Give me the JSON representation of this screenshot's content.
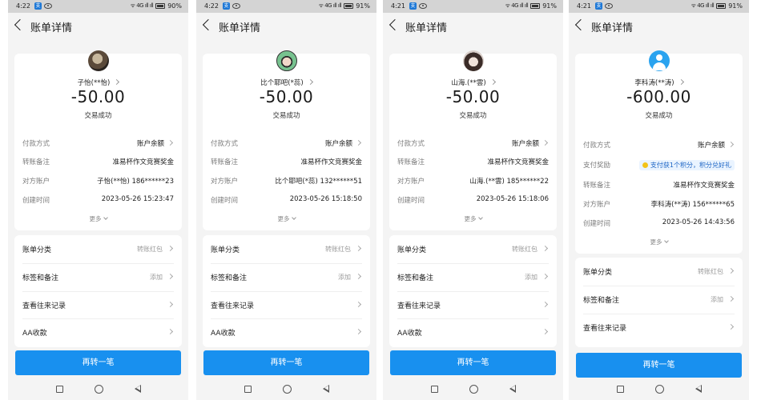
{
  "screens": [
    {
      "status": {
        "time": "4:22",
        "battery": "90%",
        "signal": "ᯤ 4G ıll ıll"
      },
      "title": "账单详情",
      "payee": "子怡(**怡)",
      "amount": "-50.00",
      "status_text": "交易成功",
      "details": [
        {
          "label": "付款方式",
          "value": "账户余额"
        },
        {
          "label": "转账备注",
          "value": "准易杯作文竞赛奖金"
        },
        {
          "label": "对方账户",
          "value": "子怡(**怡) 186******23"
        },
        {
          "label": "创建时间",
          "value": "2023-05-26 15:23:47"
        }
      ],
      "more": "更多",
      "list": [
        {
          "label": "账单分类",
          "value": "转账红包"
        },
        {
          "label": "标签和备注",
          "value": "添加"
        },
        {
          "label": "查看往来记录",
          "value": ""
        },
        {
          "label": "AA收款",
          "value": ""
        }
      ],
      "button": "再转一笔"
    },
    {
      "status": {
        "time": "4:22",
        "battery": "91%",
        "signal": "ᯤ 4G ıll ıll"
      },
      "title": "账单详情",
      "payee": "比个耶吧(*蕊)",
      "amount": "-50.00",
      "status_text": "交易成功",
      "details": [
        {
          "label": "付款方式",
          "value": "账户余额"
        },
        {
          "label": "转账备注",
          "value": "准易杯作文竞赛奖金"
        },
        {
          "label": "对方账户",
          "value": "比个耶吧(*蕊) 132******51"
        },
        {
          "label": "创建时间",
          "value": "2023-05-26 15:18:50"
        }
      ],
      "more": "更多",
      "list": [
        {
          "label": "账单分类",
          "value": "转账红包"
        },
        {
          "label": "标签和备注",
          "value": "添加"
        },
        {
          "label": "查看往来记录",
          "value": ""
        },
        {
          "label": "AA收款",
          "value": ""
        }
      ],
      "button": "再转一笔"
    },
    {
      "status": {
        "time": "4:21",
        "battery": "91%",
        "signal": "ᯤ 4G ıll ıll"
      },
      "title": "账单详情",
      "payee": "山海.(**雲)",
      "amount": "-50.00",
      "status_text": "交易成功",
      "details": [
        {
          "label": "付款方式",
          "value": "账户余额"
        },
        {
          "label": "转账备注",
          "value": "准易杯作文竞赛奖金"
        },
        {
          "label": "对方账户",
          "value": "山海.(**雲) 185******22"
        },
        {
          "label": "创建时间",
          "value": "2023-05-26 15:18:06"
        }
      ],
      "more": "更多",
      "list": [
        {
          "label": "账单分类",
          "value": "转账红包"
        },
        {
          "label": "标签和备注",
          "value": "添加"
        },
        {
          "label": "查看往来记录",
          "value": ""
        },
        {
          "label": "AA收款",
          "value": ""
        }
      ],
      "button": "再转一笔"
    },
    {
      "status": {
        "time": "4:21",
        "battery": "91%",
        "signal": "ᯤ 4G ıll ıll"
      },
      "title": "账单详情",
      "payee": "李科涛(**涛)",
      "amount": "-600.00",
      "status_text": "交易成功",
      "details": [
        {
          "label": "付款方式",
          "value": "账户余额"
        },
        {
          "label": "支付奖励",
          "value": "支付获1个积分，积分兑好礼"
        },
        {
          "label": "转账备注",
          "value": "准易杯作文竞赛奖金"
        },
        {
          "label": "对方账户",
          "value": "李科涛(**涛) 156******65"
        },
        {
          "label": "创建时间",
          "value": "2023-05-26 14:43:56"
        }
      ],
      "more": "更多",
      "list": [
        {
          "label": "账单分类",
          "value": "转账红包"
        },
        {
          "label": "标签和备注",
          "value": "添加"
        },
        {
          "label": "查看往来记录",
          "value": ""
        }
      ],
      "button": "再转一笔"
    }
  ],
  "colors": {
    "button": "#1890ef",
    "avatar_default": "#2aa3ef",
    "reward_bg": "#eaf4ff"
  },
  "icons": [
    "back-icon",
    "chevron-right-icon",
    "chevron-down-icon",
    "recents-square-icon",
    "home-circle-icon",
    "back-triangle-icon"
  ]
}
